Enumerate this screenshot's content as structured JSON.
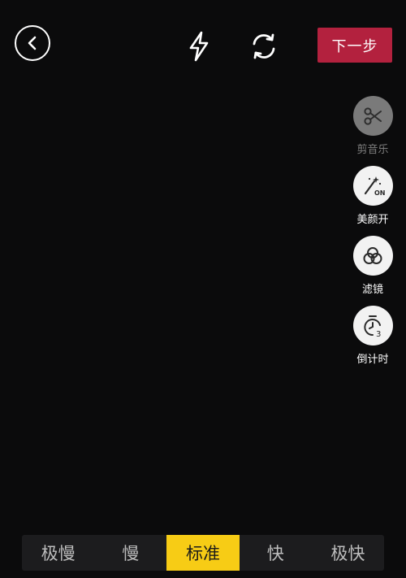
{
  "topbar": {
    "back_icon": "chevron-left-icon",
    "flash_icon": "flash-icon",
    "flip_icon": "camera-flip-icon",
    "next_label": "下一步"
  },
  "tools": [
    {
      "label": "剪音乐",
      "icon": "scissors-icon",
      "enabled": false
    },
    {
      "label": "美颜开",
      "icon": "beauty-wand-icon",
      "badge": "ON",
      "enabled": true
    },
    {
      "label": "滤镜",
      "icon": "filter-circles-icon",
      "enabled": true
    },
    {
      "label": "倒计时",
      "icon": "countdown-timer-icon",
      "badge": "3",
      "enabled": true
    }
  ],
  "speed": {
    "options": [
      "极慢",
      "慢",
      "标准",
      "快",
      "极快"
    ],
    "selected": "标准"
  },
  "colors": {
    "background": "#0b0b0c",
    "next_button": "#b3213e",
    "speed_active": "#f7cc15",
    "speed_bar": "#1c1c1e"
  }
}
